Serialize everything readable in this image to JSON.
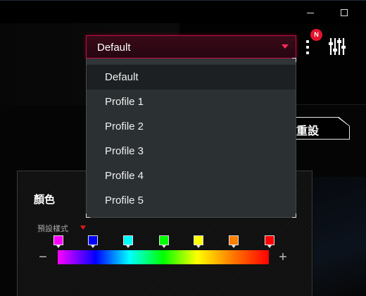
{
  "window": {
    "minimize_label": "",
    "maximize_label": ""
  },
  "profile_dropdown": {
    "selected": "Default",
    "options": [
      "Default",
      "Profile 1",
      "Profile 2",
      "Profile 3",
      "Profile 4",
      "Profile 5"
    ],
    "accent_color": "#ff2a5a"
  },
  "header": {
    "notification_badge": "N",
    "notification_color": "#e5132d"
  },
  "reset_button": {
    "label": "重設"
  },
  "color_panel": {
    "title": "顏色",
    "preset_label": "預設樣式",
    "minus_label": "−",
    "plus_label": "+",
    "swatches": [
      "#ff00ff",
      "#0000ff",
      "#00ffff",
      "#00ff00",
      "#ffff00",
      "#ff8000",
      "#ff0000"
    ]
  }
}
